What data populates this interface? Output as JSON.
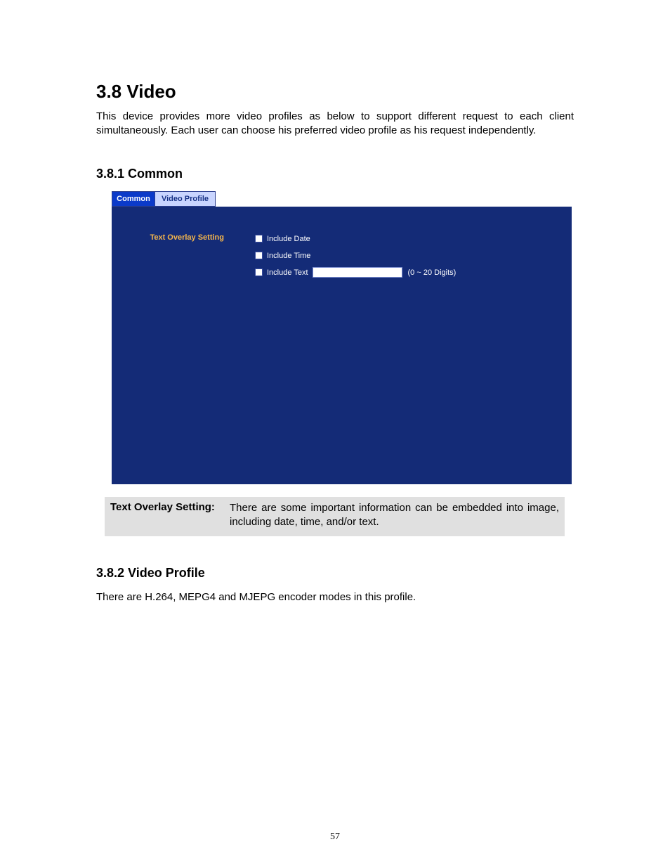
{
  "section": {
    "title": "3.8 Video",
    "intro": "This device provides more video profiles as below to support different request to each client simultaneously. Each user can choose his preferred video profile as his request independently."
  },
  "sub1": {
    "title": "3.8.1 Common",
    "tabs": {
      "active": "Common",
      "inactive": "Video Profile"
    },
    "overlay": {
      "section_label": "Text Overlay Setting",
      "include_date": "Include Date",
      "include_time": "Include Time",
      "include_text": "Include Text",
      "text_value": "",
      "text_placeholder": "",
      "digits_hint": "(0 ~ 20 Digits)"
    },
    "explain": {
      "label": "Text Overlay Setting:",
      "text": "There are some important information can be embedded into image, including date, time, and/or text."
    }
  },
  "sub2": {
    "title": "3.8.2 Video Profile",
    "body": "There are H.264, MEPG4 and MJEPG encoder modes in this profile."
  },
  "page_number": "57"
}
